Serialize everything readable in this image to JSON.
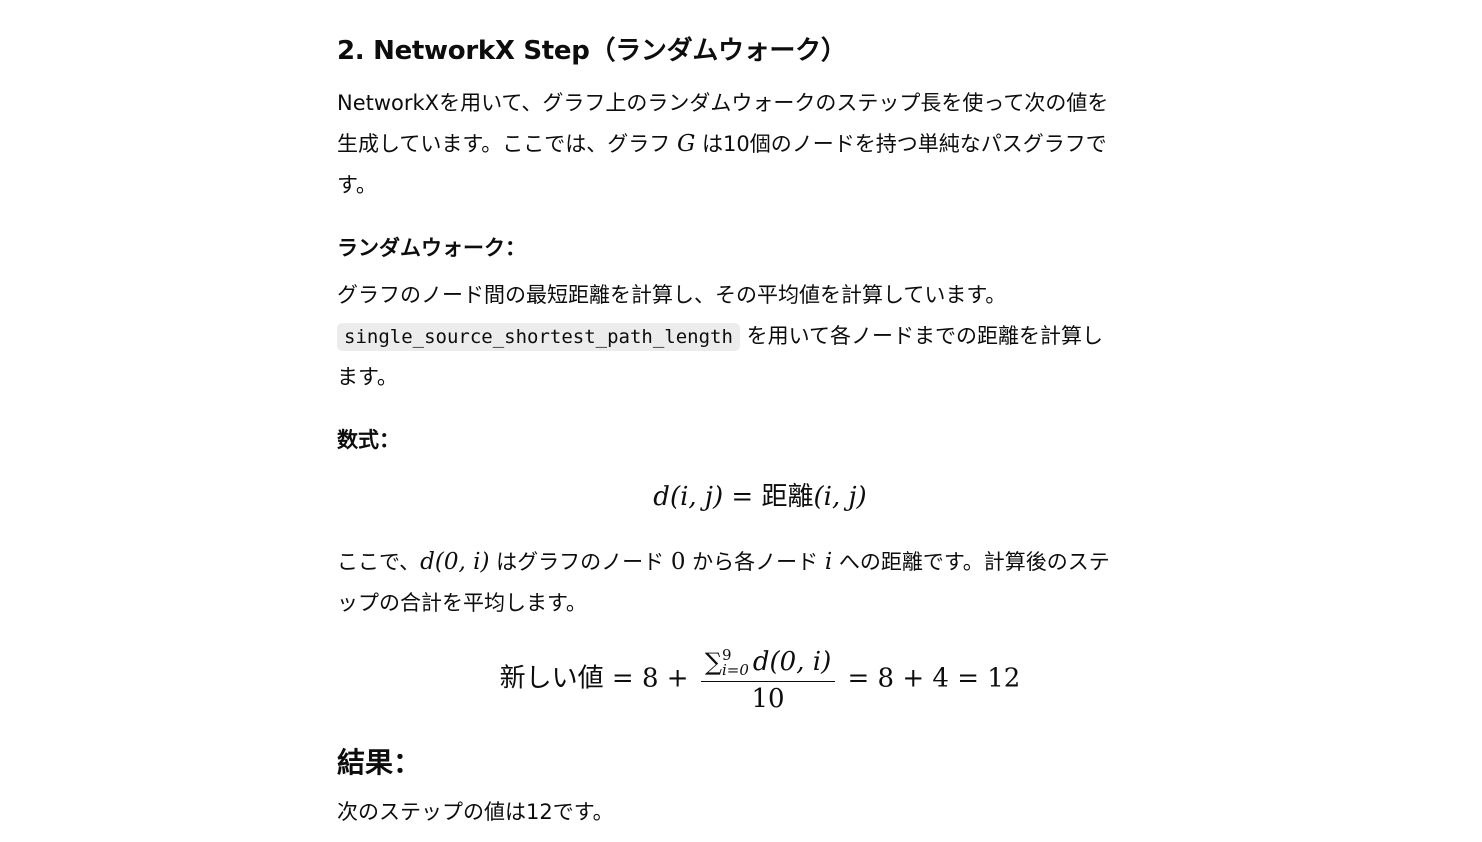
{
  "section": {
    "title": "2. NetworkX Step（ランダムウォーク）"
  },
  "intro": {
    "line1": "NetworkXを用いて、グラフ上のランダムウォークのステップ長を使って次の値を",
    "line2_pre": "生成しています。ここでは、グラフ ",
    "line2_var": "G",
    "line2_post": " は10個のノードを持つ単純なパスグラフで",
    "line3": "す。"
  },
  "random_walk": {
    "heading": "ランダムウォーク：",
    "line1": "グラフのノード間の最短距離を計算し、その平均値を計算しています。",
    "code": "single_source_shortest_path_length",
    "line2_post": " を用いて各ノードまでの距離を計算し",
    "line3": "ます。"
  },
  "formula": {
    "heading": "数式：",
    "lhs": "d(i, j)",
    "eq": " = ",
    "rhs_word": "距離",
    "rhs_args": "(i, j)"
  },
  "explanation": {
    "pre": "ここで、",
    "expr": "d(0, i)",
    "mid1": " はグラフのノード ",
    "node0": "0",
    "mid2": " から各ノード ",
    "nodei": "i",
    "post": " への距離です。計算後のステ",
    "line2": "ップの合計を平均します。"
  },
  "equation2": {
    "lhs": "新しい値",
    "eq1": " = 8 + ",
    "sum_upper": "9",
    "sum_lower": "i=0",
    "sum_term": "d(0, i)",
    "denominator": "10",
    "rest": " = 8 + 4 = 12"
  },
  "result": {
    "heading": "結果：",
    "text": "次のステップの値は12です。"
  }
}
